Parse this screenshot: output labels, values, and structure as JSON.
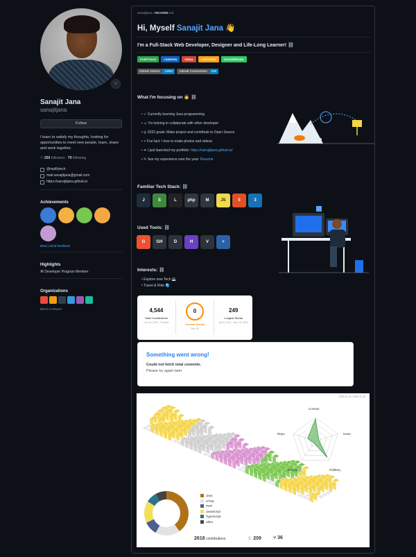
{
  "profile": {
    "name": "Sanajit Jana",
    "username": "sanajitjana",
    "follow_label": "Follow",
    "bio": "I learn to satisfy my thoughts, looking for opportunities to meet new people, learn, share and work together.",
    "followers_count": "259",
    "followers_label": "followers",
    "following_count": "79",
    "following_label": "following",
    "twitter": "@mplifytech",
    "email": "mail.sanajitjana@gmail.com",
    "website": "https://sanajitjana.github.io",
    "status_icon": "smiley-icon"
  },
  "achievements": {
    "title": "Achievements",
    "badge_count": "x3",
    "badge_colors": [
      "#3a7bd5",
      "#f5b041",
      "#7ac74f",
      "#f4a742",
      "#c39bd3"
    ],
    "beta_tags": "Beta | Send feedback"
  },
  "highlights": {
    "title": "Highlights",
    "item": "Developer Program Member"
  },
  "organizations": {
    "title": "Organizations",
    "colors": [
      "#e74c3c",
      "#f39c12",
      "#2c3e50",
      "#3498db",
      "#9b59b6",
      "#1abc9c"
    ],
    "block_label": "Block or Report"
  },
  "readme": {
    "path_user": "sanajitjana",
    "path_file": "README",
    "path_ext": ".md",
    "hi_prefix": "Hi, Myself",
    "hi_name": "Sanajit Jana",
    "hi_emoji": "👋",
    "subtitle": "I'm a Full-Stack Web Developer, Designer and Life-Long Learner!",
    "shields": [
      {
        "label": "PORTFOLIO",
        "color": "#2ea44f"
      },
      {
        "label": "LINKEDIN",
        "color": "#0a66c2"
      },
      {
        "label": "GMAIL",
        "color": "#d14836"
      },
      {
        "label": "LEETCODE",
        "color": "#ffa116"
      },
      {
        "label": "HACKERRANK",
        "color": "#2ec866"
      }
    ],
    "visitors": {
      "label": "GitHub Visitors",
      "value": "13862"
    },
    "connections": {
      "label": "GitHub Connections",
      "value": "260"
    },
    "focus_title": "What I'm focusing on",
    "focus_items": [
      "Currently learning Java programming",
      "I'm looking to collaborate with other developer",
      "2022 goals: Make project and contribute to Open Source",
      "Fun fact: I love to make photos and videos",
      "I just launched my portfolio:",
      "See my experience over the year:"
    ],
    "portfolio_link": "https://sanajitjana.github.io/",
    "resume_link": "Resume",
    "tech_title": "Familiar Tech Stack:",
    "tech": [
      {
        "name": "java-icon",
        "label": "J",
        "color": "#1d2b3a"
      },
      {
        "name": "spring-icon",
        "label": "S",
        "color": "#3d8a3d"
      },
      {
        "name": "linux-icon",
        "label": "L",
        "color": "#222"
      },
      {
        "name": "php-icon",
        "label": "php",
        "color": "#30363d"
      },
      {
        "name": "mysql-icon",
        "label": "M",
        "color": "#30363d"
      },
      {
        "name": "javascript-icon",
        "label": "JS",
        "color": "#f0db4f"
      },
      {
        "name": "html5-icon",
        "label": "5",
        "color": "#e34f26"
      },
      {
        "name": "css3-icon",
        "label": "3",
        "color": "#1572b6"
      }
    ],
    "tools_title": "Used Tools:",
    "tools": [
      {
        "name": "git-icon",
        "label": "G",
        "color": "#f05032"
      },
      {
        "name": "github-icon",
        "label": "GH",
        "color": "#2d333b"
      },
      {
        "name": "ghdesktop-icon",
        "label": "D",
        "color": "#2d333b"
      },
      {
        "name": "heroku-icon",
        "label": "H",
        "color": "#6c3fc4"
      },
      {
        "name": "vscode-icon",
        "label": "V",
        "color": "#2d333b"
      },
      {
        "name": "powershell-icon",
        "label": ">",
        "color": "#2b62a6"
      }
    ],
    "interests_title": "Interests:",
    "interests": [
      "Explore new Tech",
      "Travel & Ride"
    ]
  },
  "streak": {
    "total_num": "4,544",
    "total_label": "Total Contributions",
    "total_range": "Dec 10, 2022 - Present",
    "current_num": "0",
    "current_label": "Current Streak",
    "current_range": "Nov 18",
    "longest_num": "249",
    "longest_label": "Longest Streak",
    "longest_range": "Apr 6, 2022 - Dec 10, 2022",
    "accent": "#fb8c00"
  },
  "error_card": {
    "title": "Something went wrong!",
    "line1": "Could not fetch total commits.",
    "line2": "Please try again later"
  },
  "contrib3d": {
    "period": "2022-11-19 / 2023-11-18",
    "radar": [
      "Commit",
      "Issue",
      "PullReq",
      "Review",
      "Repo"
    ],
    "languages": [
      {
        "name": "Java",
        "color": "#b07219",
        "value": 40
      },
      {
        "name": "HTML",
        "color": "#e2e2e2",
        "value": 18
      },
      {
        "name": "PHP",
        "color": "#4f5d95",
        "value": 10
      },
      {
        "name": "JavaScript",
        "color": "#f1e05a",
        "value": 16
      },
      {
        "name": "TypeScript",
        "color": "#2b7489",
        "value": 8
      },
      {
        "name": "other",
        "color": "#444444",
        "value": 8
      }
    ],
    "contributions": "2618",
    "contributions_label": "contributions",
    "stars": "209",
    "forks": "36"
  }
}
